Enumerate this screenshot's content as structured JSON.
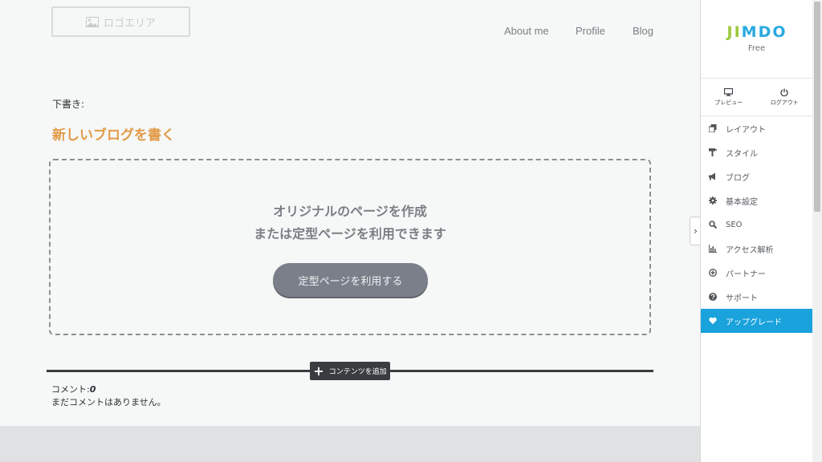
{
  "header": {
    "logo_placeholder": "ロゴエリア",
    "nav": [
      "About me",
      "Profile",
      "Blog"
    ]
  },
  "content": {
    "draft_label": "下書き:",
    "blog_title": "新しいブログを書く",
    "dropzone_line1": "オリジナルのページを作成",
    "dropzone_line2": "または定型ページを利用できます",
    "template_button": "定型ページを利用する",
    "add_content": "コンテンツを追加",
    "comments_label": "コメント:",
    "comments_count": "0",
    "no_comments": "まだコメントはありません。"
  },
  "panel": {
    "brand_letters": [
      "J",
      "I",
      "M",
      "D",
      "O"
    ],
    "brand_colors": [
      "#9cc83c",
      "#9cc83c",
      "#29a9e0",
      "#29a9e0",
      "#29a9e0"
    ],
    "plan": "Free",
    "preview": "プレビュー",
    "logout": "ログアウト",
    "menu": [
      {
        "label": "レイアウト",
        "icon": "layout-icon"
      },
      {
        "label": "スタイル",
        "icon": "paint-roller-icon"
      },
      {
        "label": "ブログ",
        "icon": "megaphone-icon"
      },
      {
        "label": "基本設定",
        "icon": "gear-icon"
      },
      {
        "label": "SEO",
        "icon": "search-icon"
      },
      {
        "label": "アクセス解析",
        "icon": "bar-chart-icon"
      },
      {
        "label": "パートナー",
        "icon": "plus-circle-icon"
      },
      {
        "label": "サポート",
        "icon": "question-icon"
      },
      {
        "label": "アップグレード",
        "icon": "heart-icon"
      }
    ],
    "accent_color": "#1aa2dc"
  }
}
